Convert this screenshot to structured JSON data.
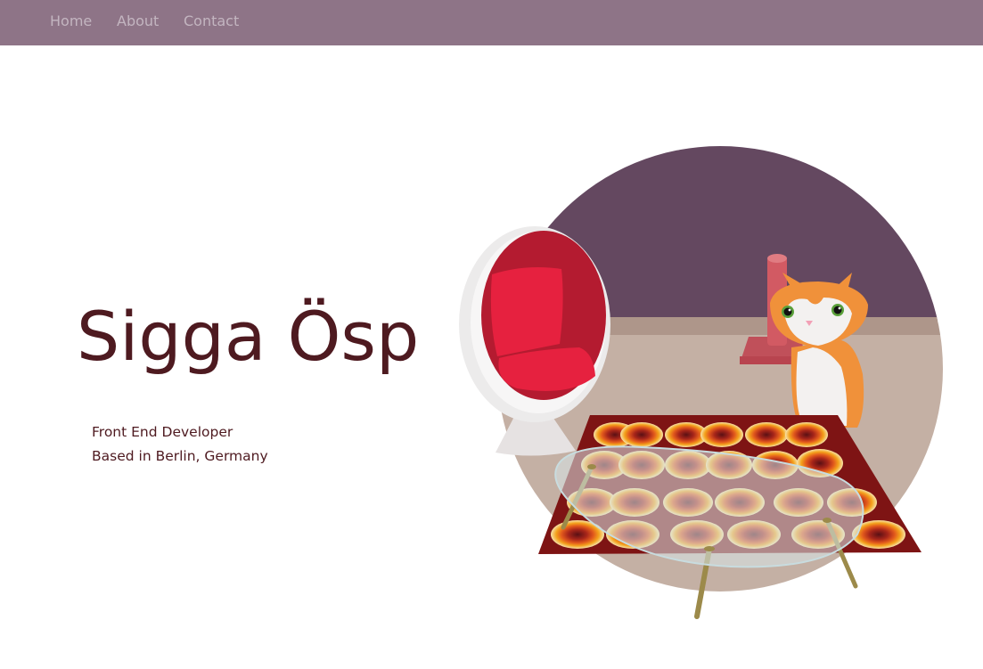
{
  "nav": {
    "items": [
      {
        "label": "Home"
      },
      {
        "label": "About"
      },
      {
        "label": "Contact"
      }
    ]
  },
  "hero": {
    "name": "Sigga Ösp",
    "role": "Front End Developer",
    "location": "Based in Berlin, Germany"
  },
  "colors": {
    "nav_background": "#8e7487",
    "nav_text": "#c3b5c0",
    "heading_text": "#4e1a20",
    "wall": "#644860",
    "floor": "#c4b0a4",
    "chair_red": "#d81f3c",
    "cat_orange": "#f0913a"
  },
  "illustration": {
    "icons": [
      "egg-chair-icon",
      "cat-icon",
      "scratching-post-icon",
      "rug-icon",
      "glass-table-icon"
    ]
  }
}
